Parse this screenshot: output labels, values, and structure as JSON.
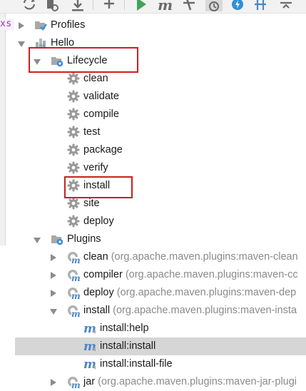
{
  "toolbar": {
    "buttons": [
      {
        "name": "reimport-icon"
      },
      {
        "name": "generate-sources-icon"
      },
      {
        "name": "download-icon"
      },
      {
        "name": "add-icon"
      },
      {
        "name": "run-icon"
      },
      {
        "name": "maven-goal-icon"
      },
      {
        "name": "toggle-offline-icon"
      },
      {
        "name": "skip-tests-icon"
      },
      {
        "name": "lightning-icon"
      },
      {
        "name": "show-dependencies-icon"
      },
      {
        "name": "collapse-all-icon"
      }
    ]
  },
  "editor_gutter": {
    "fragment": "xs"
  },
  "tree": {
    "profiles": "Profiles",
    "project": "Hello",
    "lifecycle": {
      "label": "Lifecycle",
      "phases": [
        "clean",
        "validate",
        "compile",
        "test",
        "package",
        "verify",
        "install",
        "site",
        "deploy"
      ]
    },
    "plugins": {
      "label": "Plugins",
      "items": [
        {
          "name": "clean",
          "detail": "(org.apache.maven.plugins:maven-clean"
        },
        {
          "name": "compiler",
          "detail": "(org.apache.maven.plugins:maven-cc"
        },
        {
          "name": "deploy",
          "detail": "(org.apache.maven.plugins:maven-dep"
        },
        {
          "name": "install",
          "detail": "(org.apache.maven.plugins:maven-insta",
          "goals": [
            "install:help",
            "install:install",
            "install:install-file"
          ]
        },
        {
          "name": "jar",
          "detail": "(org.apache.maven.plugins:maven-jar-plugi"
        }
      ]
    }
  },
  "selected_goal": "install:install",
  "colors": {
    "selection": "#d6d6d6",
    "highlight_box": "#cc1f1f",
    "folder_blue": "#3d8fd6",
    "gear_gray": "#9a9a9a",
    "plugin_m_blue": "#4a86c8"
  }
}
